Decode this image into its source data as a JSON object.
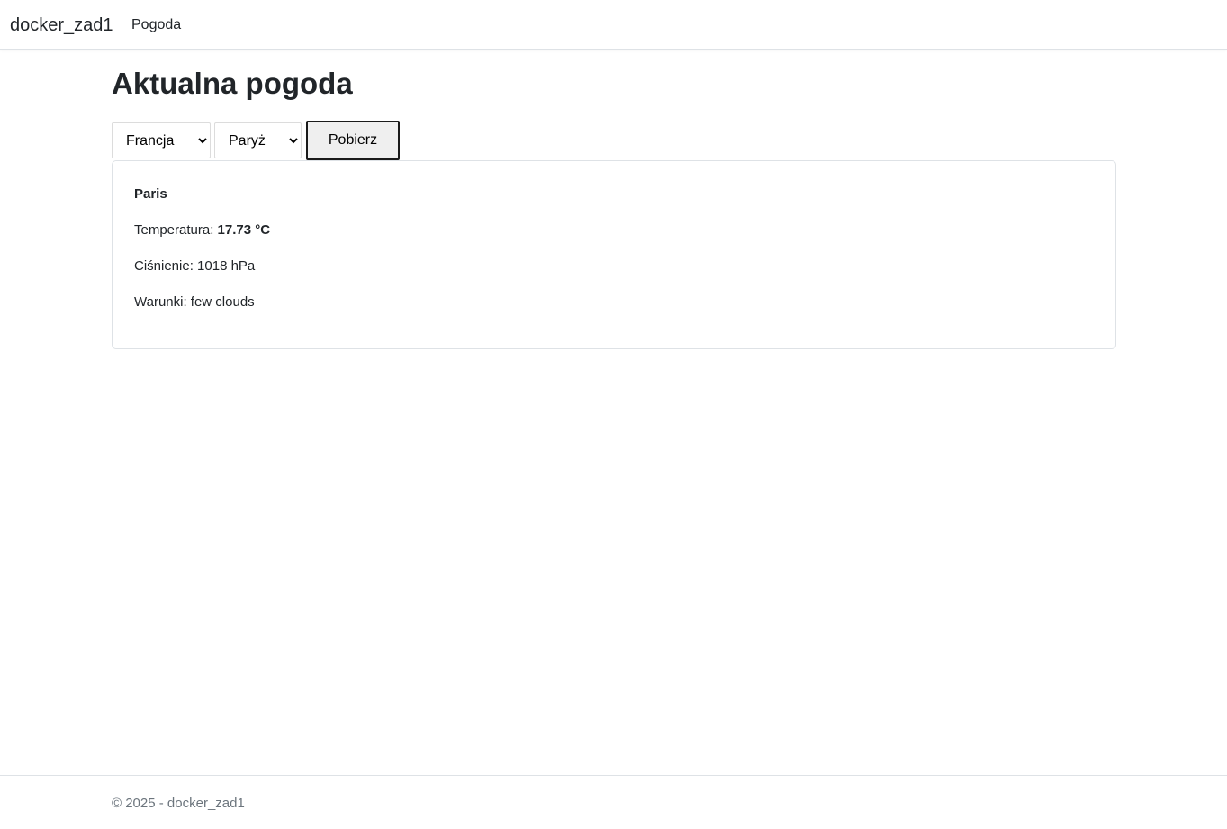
{
  "navbar": {
    "brand": "docker_zad1",
    "links": [
      {
        "label": "Pogoda"
      }
    ]
  },
  "main": {
    "title": "Aktualna pogoda",
    "country_select": {
      "selected": "Francja"
    },
    "city_select": {
      "selected": "Paryż"
    },
    "fetch_button": "Pobierz"
  },
  "weather": {
    "city": "Paris",
    "temperature_label": "Temperatura: ",
    "temperature_value": "17.73 °C",
    "pressure_label": "Ciśnienie: ",
    "pressure_value": "1018 hPa",
    "conditions_label": "Warunki: ",
    "conditions_value": "few clouds"
  },
  "footer": {
    "text": "© 2025 - docker_zad1"
  }
}
